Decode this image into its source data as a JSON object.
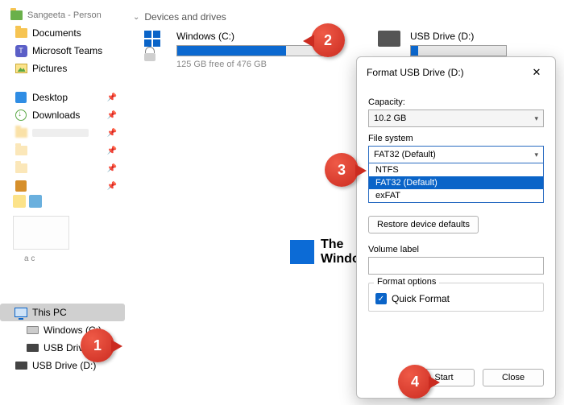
{
  "sidebar": {
    "user_title": "Sangeeta - Person",
    "top_items": [
      {
        "label": "Documents",
        "icon": "folder"
      },
      {
        "label": "Microsoft Teams",
        "icon": "teams"
      },
      {
        "label": "Pictures",
        "icon": "pictures"
      }
    ],
    "quick_items": [
      {
        "label": "Desktop",
        "icon": "desktop"
      },
      {
        "label": "Downloads",
        "icon": "download"
      }
    ],
    "note": "a c",
    "this_pc_label": "This PC",
    "this_pc_children": [
      {
        "label": "Windows (C:)",
        "icon": "drive"
      },
      {
        "label": "USB Drive (D:)",
        "icon": "usb"
      }
    ],
    "loose_usb": {
      "label": "USB Drive (D:)",
      "icon": "usb"
    }
  },
  "main": {
    "section_title": "Devices and drives",
    "drives": [
      {
        "name": "Windows (C:)",
        "fill_pct": 72,
        "subtext": "125 GB free of 476 GB"
      },
      {
        "name": "USB Drive (D:)",
        "fill_pct": 8,
        "subtext": ""
      }
    ]
  },
  "watermark": {
    "line1": "The",
    "line2": "WindowsClub"
  },
  "dialog": {
    "title": "Format USB Drive (D:)",
    "capacity": {
      "label": "Capacity:",
      "value": "10.2 GB"
    },
    "file_system": {
      "label": "File system",
      "selected": "FAT32 (Default)"
    },
    "fs_options": {
      "o1": "NTFS",
      "o2": "FAT32 (Default)",
      "o3": "exFAT"
    },
    "restore_label": "Restore device defaults",
    "volume_label": "Volume label",
    "volume_value": "",
    "format_options": {
      "group": "Format options",
      "quick": "Quick Format"
    },
    "start": "Start",
    "close": "Close"
  },
  "callouts": {
    "c1": "1",
    "c2": "2",
    "c3": "3",
    "c4": "4"
  }
}
